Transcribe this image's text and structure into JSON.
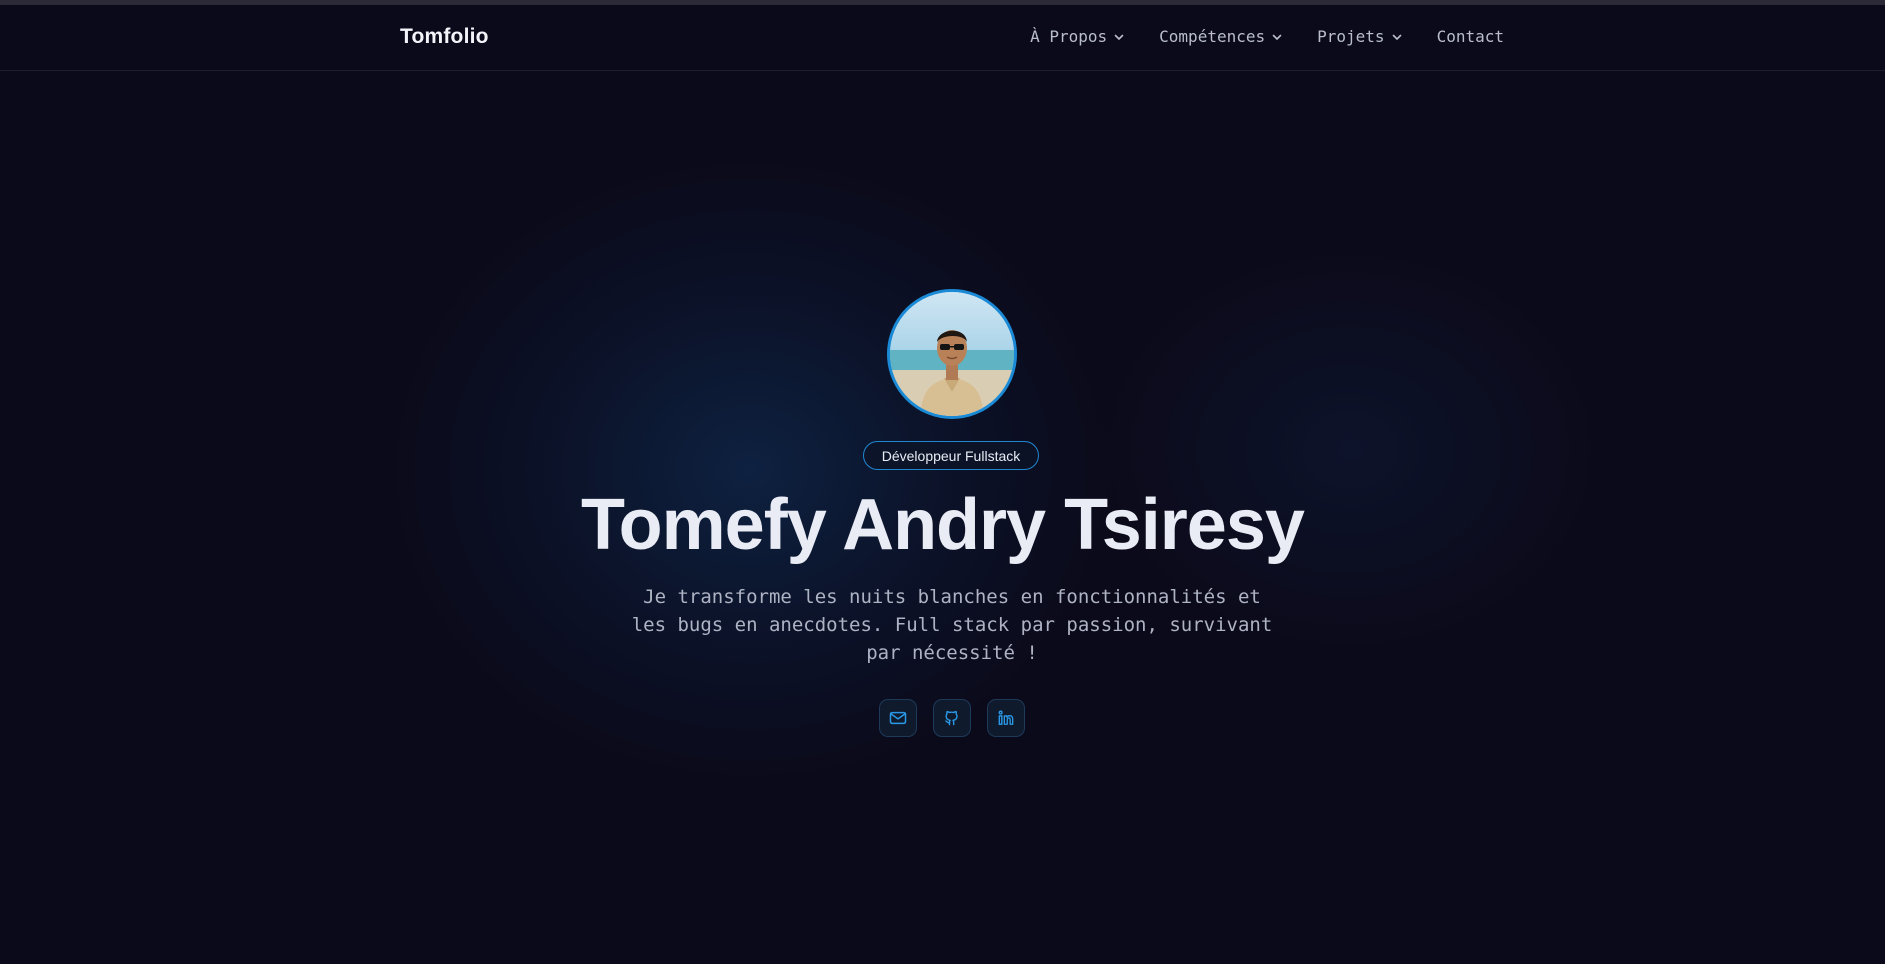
{
  "header": {
    "brand": "Tomfolio",
    "nav": [
      {
        "label": "À Propos",
        "has_dropdown": true
      },
      {
        "label": "Compétences",
        "has_dropdown": true
      },
      {
        "label": "Projets",
        "has_dropdown": true
      },
      {
        "label": "Contact",
        "has_dropdown": false
      }
    ]
  },
  "hero": {
    "avatar_icon": "profile-photo",
    "role_badge": "Développeur Fullstack",
    "name": "Tomefy Andry Tsiresy",
    "tagline_lines": [
      "Je transforme les nuits blanches en fonctionnalités et",
      "les bugs en anecdotes. Full stack par passion, survivant",
      "par nécessité !"
    ],
    "socials": [
      {
        "icon": "mail-icon"
      },
      {
        "icon": "github-icon"
      },
      {
        "icon": "linkedin-icon"
      }
    ]
  },
  "colors": {
    "background": "#0b0a1a",
    "accent": "#1b8ad6",
    "text_primary": "#e9ecf4",
    "text_muted": "#aeb3c4"
  }
}
